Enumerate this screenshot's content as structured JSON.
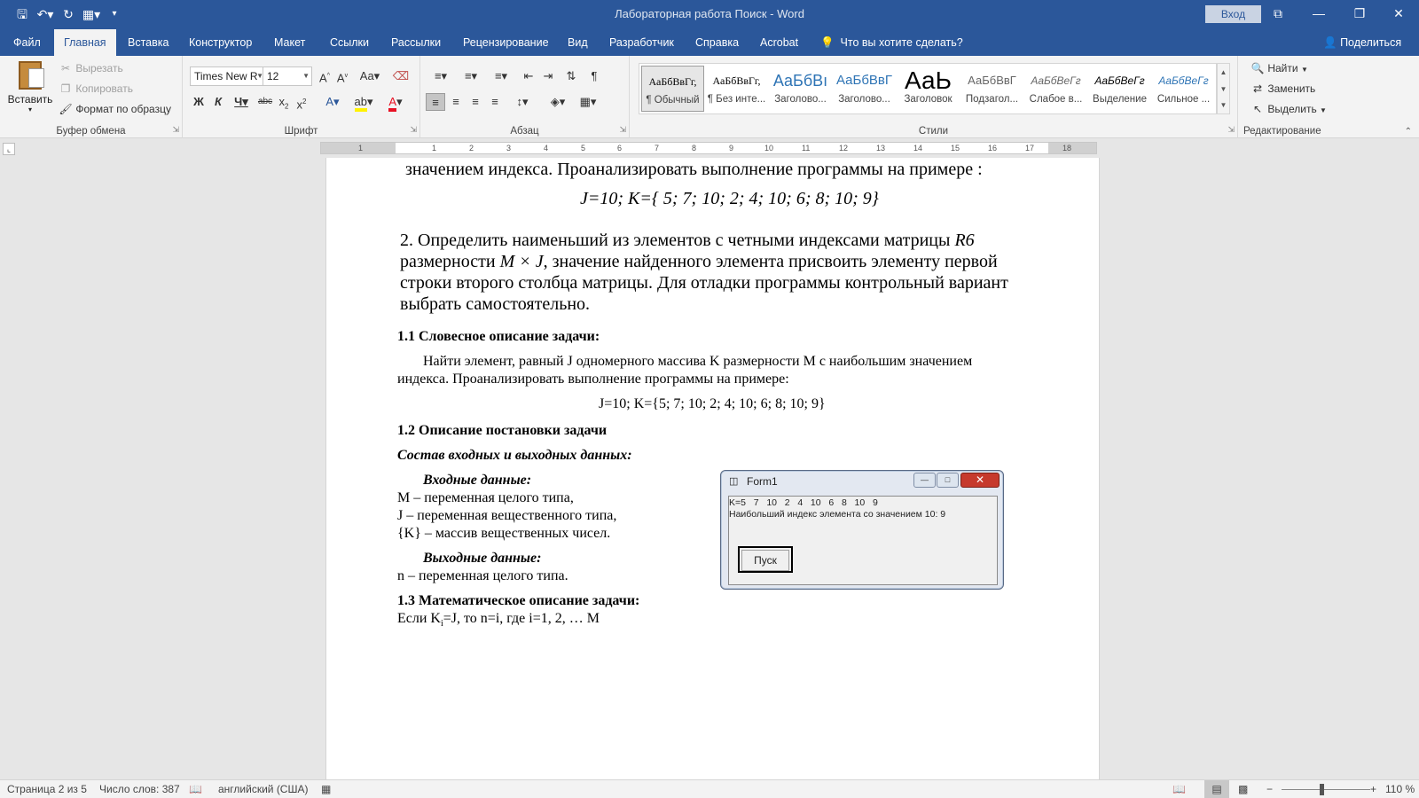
{
  "window": {
    "title": "Лабораторная работа Поиск  -  Word",
    "login_label": "Вход",
    "controls": {
      "ribbon_opts": "⧉",
      "minimize": "—",
      "restore": "❐",
      "close": "✕"
    }
  },
  "qat": {
    "save_icon": "save-icon",
    "undo_icon": "undo-icon",
    "redo_icon": "redo-icon",
    "layout_icon": "layout-icon",
    "customize_icon": "customize-icon"
  },
  "menu": {
    "tabs": [
      "Файл",
      "Главная",
      "Вставка",
      "Конструктор",
      "Макет",
      "Ссылки",
      "Рассылки",
      "Рецензирование",
      "Вид",
      "Разработчик",
      "Справка",
      "Acrobat"
    ],
    "active": "Главная",
    "tell_me": "Что вы хотите сделать?",
    "share": "Поделиться"
  },
  "ribbon": {
    "clipboard": {
      "paste": "Вставить",
      "cut": "Вырезать",
      "copy": "Копировать",
      "format_painter": "Формат по образцу",
      "label": "Буфер обмена"
    },
    "font": {
      "name": "Times New R",
      "size": "12",
      "label": "Шрифт"
    },
    "paragraph": {
      "label": "Абзац"
    },
    "styles": {
      "label": "Стили",
      "items": [
        {
          "preview": "АаБбВвГг,",
          "name": "¶ Обычный"
        },
        {
          "preview": "АаБбВвГг,",
          "name": "¶ Без инте..."
        },
        {
          "preview": "АаБбВı",
          "name": "Заголово..."
        },
        {
          "preview": "АаБбВвГ",
          "name": "Заголово..."
        },
        {
          "preview": "АаЬ",
          "name": "Заголовок"
        },
        {
          "preview": "АаБбВвГ",
          "name": "Подзагол..."
        },
        {
          "preview": "АаБбВеГг",
          "name": "Слабое в..."
        },
        {
          "preview": "АаБбВеГг",
          "name": "Выделение"
        },
        {
          "preview": "АаБбВеГг",
          "name": "Сильное ..."
        }
      ]
    },
    "editing": {
      "find": "Найти",
      "replace": "Заменить",
      "select": "Выделить",
      "label": "Редактирование"
    }
  },
  "document": {
    "l1": "значением индекса. Проанализировать выполнение программы на примере :",
    "l2": "J=10;        K={ 5; 7; 10; 2; 4; 10; 6; 8; 10; 9}",
    "l3a": "2. Определить наименьший  из элементов с четными индексами матрицы ",
    "l3b": "R6",
    "l4a": "размерности ",
    "l4b": "M × J",
    "l4c": ", значение найденного элемента присвоить элементу первой",
    "l5": "строки второго столбца матрицы. Для отладки программы контрольный вариант",
    "l6": "выбрать самостоятельно.",
    "h11": "1.1 Словесное описание задачи:",
    "p1": "Найти элемент, равный J одномерного массива K размерности M с наибольшим значением",
    "p2": "индекса. Проанализировать выполнение программы на примере:",
    "ex": "J=10;        K={5; 7; 10; 2; 4; 10; 6; 8; 10; 9}",
    "h12": "1.2  Описание постановки задачи",
    "io": "Состав входных и выходных данных:",
    "in_h": "Входные данные:",
    "in1": "M – переменная целого типа,",
    "in2": "J – переменная вещественного типа,",
    "in3": "{K} – массив вещественных чисел.",
    "out_h": "Выходные данные:",
    "out1": "n – переменная целого типа.",
    "h13": "1.3 Математическое описание задачи:",
    "m1a": "Если K",
    "m1b": "i",
    "m1c": "=J, то n=i, где i=1, 2, … M"
  },
  "form1": {
    "title": "Form1",
    "line1": "K=5   7   10   2   4   10   6   8   10   9",
    "line2": "Наибольший индекс элемента со значением 10: 9",
    "button": "Пуск"
  },
  "status": {
    "page": "Страница 2 из 5",
    "words": "Число слов: 387",
    "lang": "английский (США)",
    "zoom": "110 %"
  },
  "colors": {
    "accent": "#2b579a",
    "ribbon": "#f3f3f3",
    "canvas": "#e6e6e6",
    "font_color_bar": "#e81123",
    "highlight_bar": "#fff200"
  }
}
